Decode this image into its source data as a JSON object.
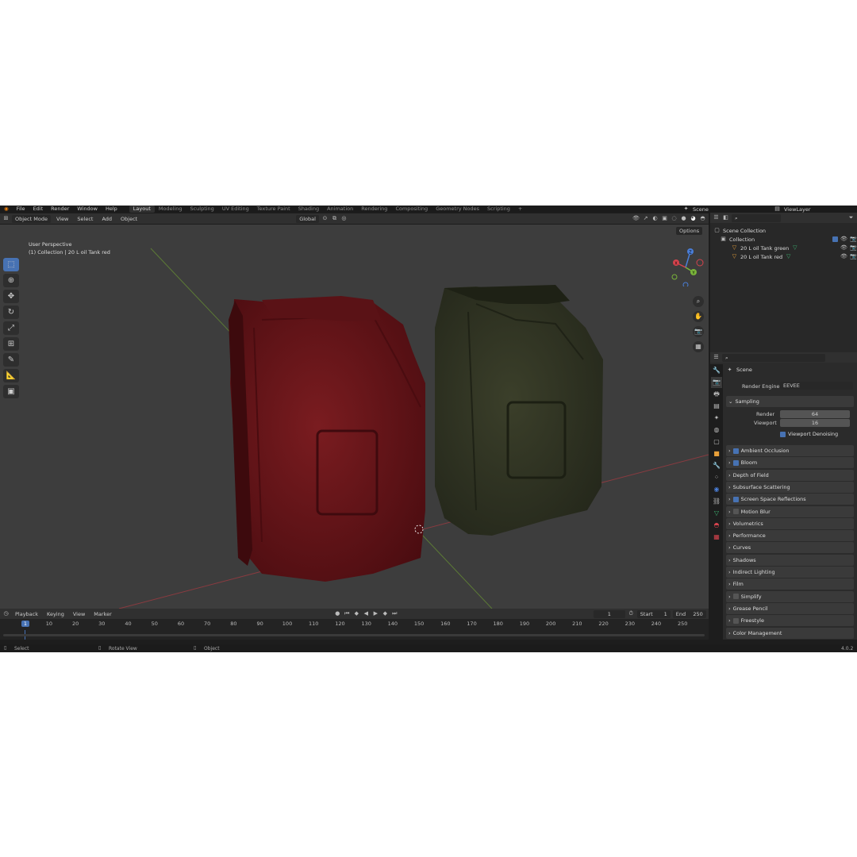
{
  "menu": {
    "items": [
      "File",
      "Edit",
      "Render",
      "Window",
      "Help"
    ],
    "workspaces": [
      "Layout",
      "Modeling",
      "Sculpting",
      "UV Editing",
      "Texture Paint",
      "Shading",
      "Animation",
      "Rendering",
      "Compositing",
      "Geometry Nodes",
      "Scripting",
      "+"
    ],
    "active_workspace": "Layout",
    "scene": "Scene",
    "view_layer": "ViewLayer"
  },
  "viewport_header": {
    "mode": "Object Mode",
    "menus": [
      "View",
      "Select",
      "Add",
      "Object"
    ],
    "transform_orientation": "Global",
    "options": "Options"
  },
  "viewport": {
    "perspective": "User Perspective",
    "collection_info": "(1) Collection | 20 L oil Tank red",
    "gizmo_labels": {
      "x": "X",
      "y": "Y",
      "z": "Z"
    }
  },
  "outliner": {
    "root": "Scene Collection",
    "collection": "Collection",
    "objects": [
      "20 L oil Tank green",
      "20 L oil Tank red"
    ]
  },
  "properties": {
    "context": "Scene",
    "render_engine_label": "Render Engine",
    "render_engine": "EEVEE",
    "sampling_label": "Sampling",
    "render_label": "Render",
    "render_samples": "64",
    "viewport_label": "Viewport",
    "viewport_samples": "16",
    "denoise_label": "Viewport Denoising",
    "panels": [
      {
        "label": "Ambient Occlusion",
        "checkbox": true,
        "checked": true
      },
      {
        "label": "Bloom",
        "checkbox": true,
        "checked": true
      },
      {
        "label": "Depth of Field",
        "checkbox": false,
        "checked": false
      },
      {
        "label": "Subsurface Scattering",
        "checkbox": false,
        "checked": false
      },
      {
        "label": "Screen Space Reflections",
        "checkbox": true,
        "checked": true
      },
      {
        "label": "Motion Blur",
        "checkbox": true,
        "checked": false
      },
      {
        "label": "Volumetrics",
        "checkbox": false,
        "checked": false
      },
      {
        "label": "Performance",
        "checkbox": false,
        "checked": false
      },
      {
        "label": "Curves",
        "checkbox": false,
        "checked": false
      },
      {
        "label": "Shadows",
        "checkbox": false,
        "checked": false
      },
      {
        "label": "Indirect Lighting",
        "checkbox": false,
        "checked": false
      },
      {
        "label": "Film",
        "checkbox": false,
        "checked": false
      },
      {
        "label": "Simplify",
        "checkbox": true,
        "checked": false
      },
      {
        "label": "Grease Pencil",
        "checkbox": false,
        "checked": false
      },
      {
        "label": "Freestyle",
        "checkbox": true,
        "checked": false
      },
      {
        "label": "Color Management",
        "checkbox": false,
        "checked": false
      }
    ]
  },
  "timeline": {
    "menus": [
      "Playback",
      "Keying",
      "View",
      "Marker"
    ],
    "current_frame": "1",
    "start_label": "Start",
    "start": "1",
    "end_label": "End",
    "end": "250",
    "ticks": [
      "1",
      "10",
      "20",
      "30",
      "40",
      "50",
      "60",
      "70",
      "80",
      "90",
      "100",
      "110",
      "120",
      "130",
      "140",
      "150",
      "160",
      "170",
      "180",
      "190",
      "200",
      "210",
      "220",
      "230",
      "240",
      "250"
    ]
  },
  "statusbar": {
    "select": "Select",
    "rotate": "Rotate View",
    "object": "Object",
    "version": "4.0.2"
  },
  "colors": {
    "accent": "#4772b3",
    "tank_red": "#6b1518",
    "tank_green": "#2f3320"
  }
}
